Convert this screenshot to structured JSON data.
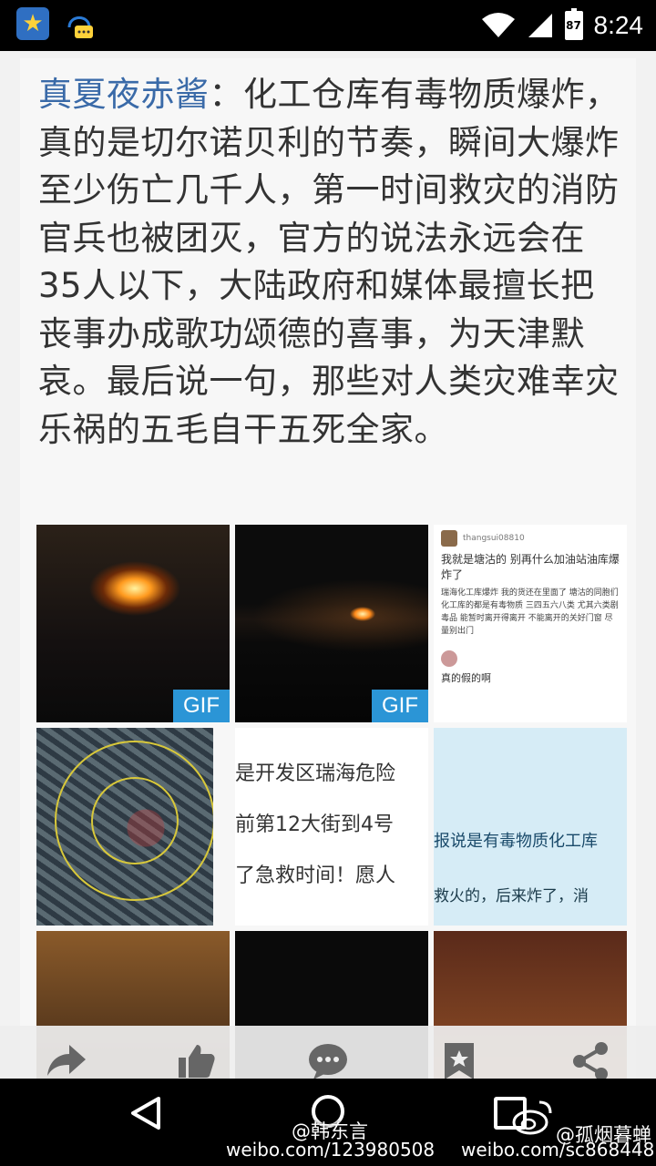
{
  "status_bar": {
    "time": "8:24",
    "battery": "87",
    "icons": [
      "app-star-icon",
      "chat-bubble-icon",
      "wifi-icon",
      "signal-icon",
      "battery-icon"
    ]
  },
  "post": {
    "author": "真夏夜赤酱",
    "separator": "：",
    "body": "化工仓库有毒物质爆炸，真的是切尔诺贝利的节奏，瞬间大爆炸至少伤亡几千人，第一时间救灾的消防官兵也被团灭，官方的说法永远会在35人以下，大陆政府和媒体最擅长把丧事办成歌功颂德的喜事，为天津默哀。最后说一句，那些对人类灾难幸灾乐祸的五毛自干五死全家。"
  },
  "images": {
    "gif_badge": "GIF",
    "chat": {
      "name": "thangsui08810",
      "line1": "我就是塘沽的 别再什么加油站油库爆炸了",
      "line2": "瑞海化工库爆炸 我的货还在里面了 塘沽的同胞们 化工库的都是有毒物质 三四五六八类 尤其六类剧毒品 能暂时离开得离开 不能离开的关好门窗 尽量别出门",
      "reply": "真的假的啊"
    },
    "news1": {
      "line1": "是开发区瑞海危险",
      "line2": "前第12大街到4号",
      "line3": "了急救时间！愿人"
    },
    "news2": {
      "line1": "报说是有毒物质化工库",
      "line2": "救火的，后来炸了，消"
    }
  },
  "actions": [
    {
      "label": "转发",
      "icon": "repost-icon"
    },
    {
      "label": "赞",
      "icon": "thumbs-up-icon"
    },
    {
      "label": "评论",
      "icon": "comment-icon"
    },
    {
      "label": "收藏",
      "icon": "bookmark-icon"
    },
    {
      "label": "分享",
      "icon": "share-icon"
    }
  ],
  "watermarks": {
    "user1": "@韩东言",
    "url1": "weibo.com/123980508",
    "user2": "@孤烟暮蝉",
    "url2": "weibo.com/sc868448"
  },
  "colors": {
    "author": "#3a6aa8",
    "gif_badge": "#2b95d6"
  }
}
